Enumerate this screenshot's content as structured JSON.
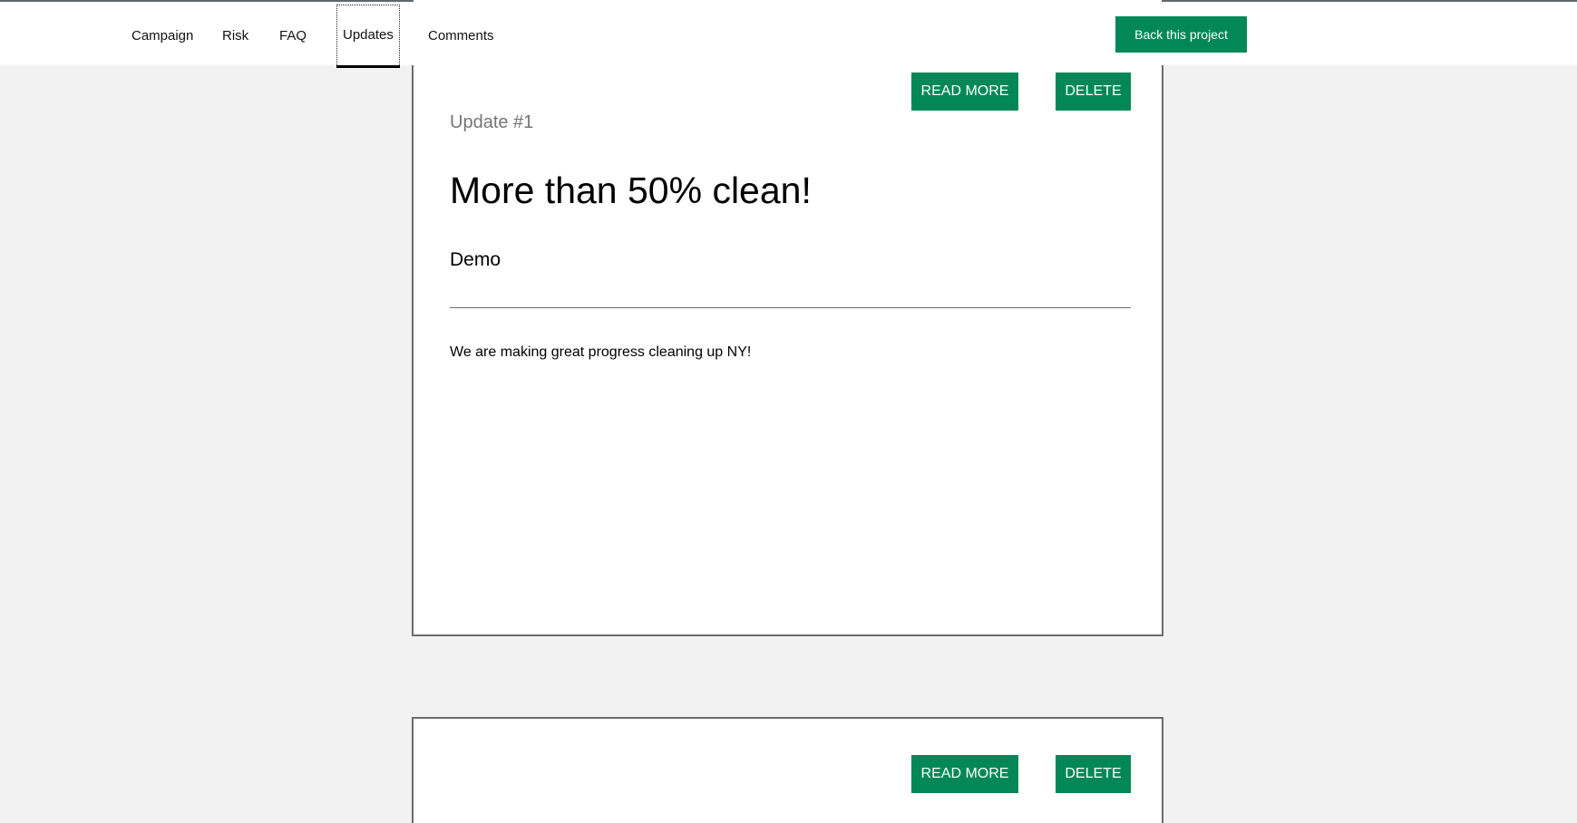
{
  "nav": {
    "tabs": [
      {
        "label": "Campaign"
      },
      {
        "label": "Risk"
      },
      {
        "label": "FAQ"
      },
      {
        "label": "Updates",
        "active": true
      },
      {
        "label": "Comments"
      }
    ],
    "back_button_label": "Back this project"
  },
  "updates": [
    {
      "read_more_label": "READ MORE",
      "delete_label": "DELETE",
      "number": "Update #1",
      "title": "More than 50% clean!",
      "author": "Demo",
      "body": "We are making great progress cleaning up NY!"
    },
    {
      "read_more_label": "READ MORE",
      "delete_label": "DELETE"
    }
  ],
  "colors": {
    "accent": "#028858",
    "background": "#f2f2f2",
    "card_border": "#6b6b6b",
    "muted_text": "#757575"
  }
}
